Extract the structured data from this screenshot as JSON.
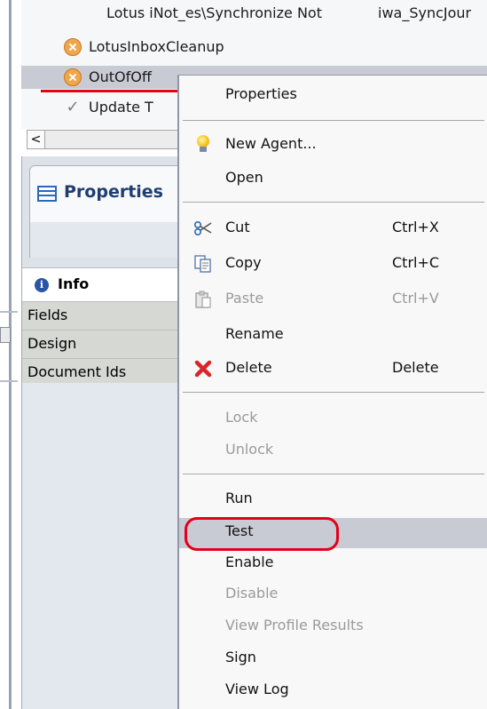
{
  "agent_list": {
    "rows": [
      {
        "label": "Lotus iNot_es\\Synchronize Not",
        "col2": "iwa_SyncJour",
        "icon": "none"
      },
      {
        "label": "LotusInboxCleanup",
        "col2": "",
        "icon": "error-x-icon"
      },
      {
        "label": "OutOfOff",
        "col2": "",
        "icon": "error-x-icon",
        "selected": true
      },
      {
        "label": "Update T",
        "col2": "",
        "icon": "checkmark-icon"
      }
    ]
  },
  "scrollbar": {
    "left_arrow": "<"
  },
  "properties_panel": {
    "tab_label": "Properties",
    "sections": [
      {
        "label": "Info",
        "icon": "info-icon",
        "active": true
      },
      {
        "label": "Fields"
      },
      {
        "label": "Design"
      },
      {
        "label": "Document Ids"
      }
    ]
  },
  "context_menu": {
    "items": [
      {
        "label": "Properties",
        "mnemonic": "e"
      },
      {
        "label": "New Agent...",
        "icon": "lightbulb-icon"
      },
      {
        "label": "Open"
      },
      {
        "label": "Cut",
        "shortcut": "Ctrl+X",
        "icon": "scissors-icon"
      },
      {
        "label": "Copy",
        "shortcut": "Ctrl+C",
        "icon": "copy-icon"
      },
      {
        "label": "Paste",
        "shortcut": "Ctrl+V",
        "icon": "paste-icon",
        "disabled": true
      },
      {
        "label": "Rename"
      },
      {
        "label": "Delete",
        "shortcut": "Delete",
        "icon": "delete-x-icon"
      },
      {
        "label": "Lock",
        "disabled": true
      },
      {
        "label": "Unlock",
        "disabled": true
      },
      {
        "label": "Run"
      },
      {
        "label": "Test",
        "highlighted": true
      },
      {
        "label": "Enable"
      },
      {
        "label": "Disable",
        "disabled": true
      },
      {
        "label": "View Profile Results",
        "disabled": true
      },
      {
        "label": "Sign"
      },
      {
        "label": "View Log"
      }
    ]
  },
  "colors": {
    "highlight_ring": "#e3001b",
    "selection": "#c9cbd4",
    "accent_blue": "#2a69b5"
  }
}
